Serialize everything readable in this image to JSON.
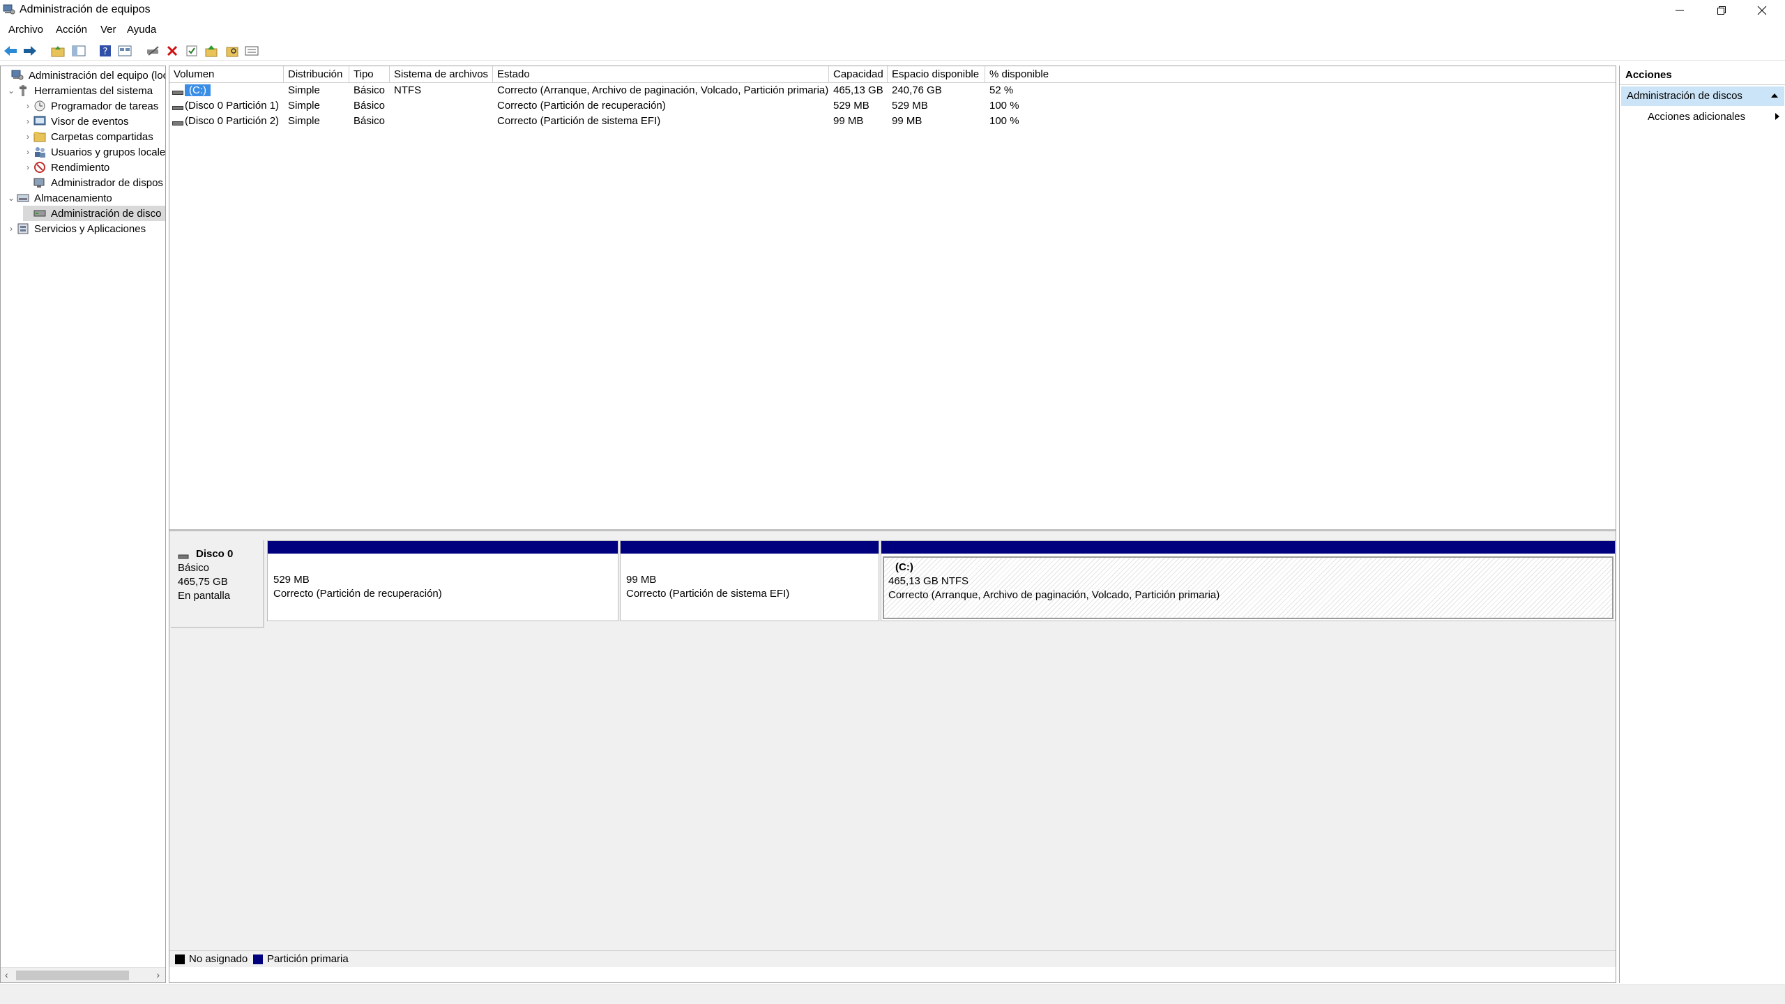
{
  "window": {
    "title": "Administración de equipos",
    "app_icon": "computer-management-icon"
  },
  "menu": [
    "Archivo",
    "Acción",
    "Ver",
    "Ayuda"
  ],
  "tree": {
    "items": [
      {
        "label": "Administración del equipo (loca",
        "icon": "computer-management-icon",
        "expand": ""
      },
      {
        "label": "Herramientas del sistema",
        "icon": "tools-icon",
        "expand": "⌄"
      },
      {
        "label": "Programador de tareas",
        "icon": "clock-icon",
        "expand": "›"
      },
      {
        "label": "Visor de eventos",
        "icon": "event-viewer-icon",
        "expand": "›"
      },
      {
        "label": "Carpetas compartidas",
        "icon": "shared-folder-icon",
        "expand": "›"
      },
      {
        "label": "Usuarios y grupos locale",
        "icon": "users-icon",
        "expand": "›"
      },
      {
        "label": "Rendimiento",
        "icon": "performance-icon",
        "expand": "›"
      },
      {
        "label": "Administrador de dispos",
        "icon": "device-manager-icon",
        "expand": ""
      },
      {
        "label": "Almacenamiento",
        "icon": "storage-icon",
        "expand": "⌄"
      },
      {
        "label": "Administración de disco",
        "icon": "disk-icon",
        "expand": ""
      },
      {
        "label": "Servicios y Aplicaciones",
        "icon": "services-icon",
        "expand": "›"
      }
    ]
  },
  "volumes": {
    "columns": [
      "Volumen",
      "Distribución",
      "Tipo",
      "Sistema de archivos",
      "Estado",
      "Capacidad",
      "Espacio disponible",
      "% disponible"
    ],
    "rows": [
      [
        "(C:)",
        "Simple",
        "Básico",
        "NTFS",
        "Correcto (Arranque, Archivo de paginación, Volcado, Partición primaria)",
        "465,13 GB",
        "240,76 GB",
        "52 %"
      ],
      [
        "(Disco 0 Partición 1)",
        "Simple",
        "Básico",
        "",
        "Correcto (Partición de recuperación)",
        "529 MB",
        "529 MB",
        "100 %"
      ],
      [
        "(Disco 0 Partición 2)",
        "Simple",
        "Básico",
        "",
        "Correcto (Partición de sistema EFI)",
        "99 MB",
        "99 MB",
        "100 %"
      ]
    ]
  },
  "disk": {
    "name": "Disco 0",
    "type": "Básico",
    "size": "465,75 GB",
    "status": "En pantalla",
    "partitions": [
      {
        "title": "",
        "size": "529 MB",
        "status": "Correcto (Partición de recuperación)"
      },
      {
        "title": "",
        "size": "99 MB",
        "status": "Correcto (Partición de sistema EFI)"
      },
      {
        "title": "(C:)",
        "size": "465,13 GB NTFS",
        "status": "Correcto (Arranque, Archivo de paginación, Volcado, Partición primaria)"
      }
    ]
  },
  "legend": {
    "unallocated": "No asignado",
    "primary": "Partición primaria",
    "unallocated_color": "#000000",
    "primary_color": "#00007f"
  },
  "actions": {
    "header": "Acciones",
    "section": "Administración de discos",
    "more": "Acciones adicionales"
  }
}
